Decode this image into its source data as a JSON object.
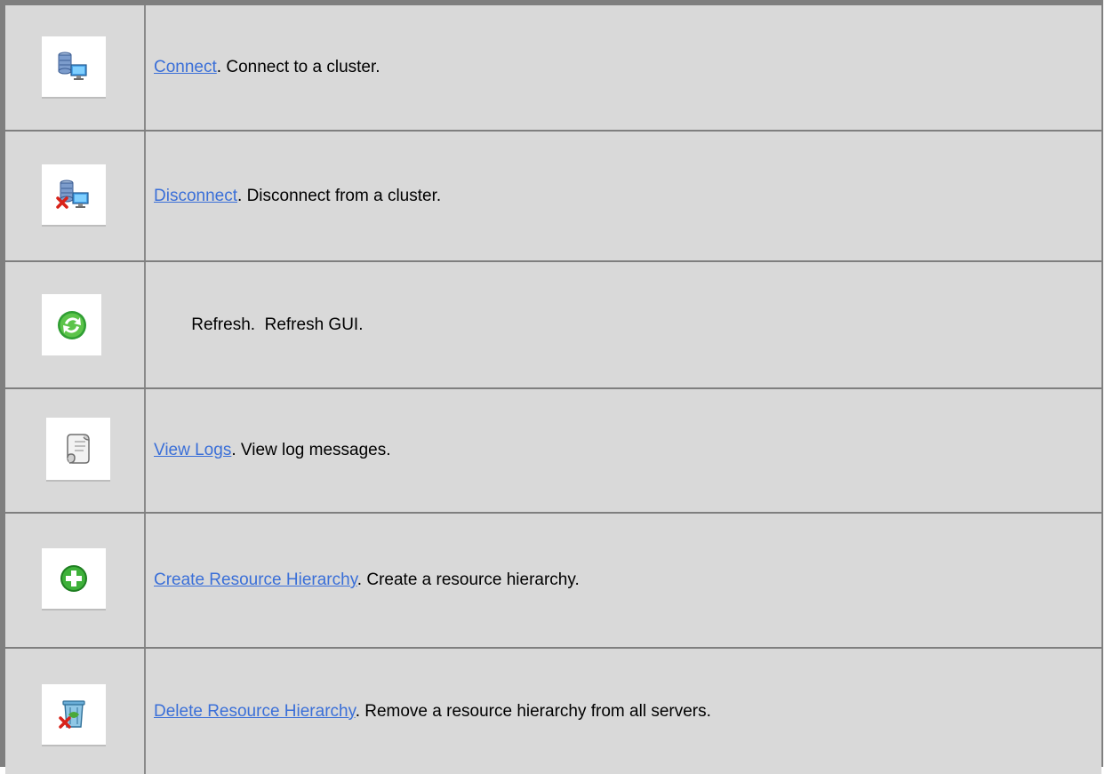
{
  "rows": [
    {
      "icon": "connect-server-icon",
      "link": "Connect",
      "sep": ". ",
      "desc": "Connect to a cluster."
    },
    {
      "icon": "disconnect-server-icon",
      "link": "Disconnect",
      "sep": ". ",
      "desc": "Disconnect from a cluster."
    },
    {
      "icon": "refresh-icon",
      "label": "Refresh.",
      "desc": "  Refresh GUI."
    },
    {
      "icon": "log-scroll-icon",
      "link": "View Logs",
      "sep": ". ",
      "desc": "View log messages."
    },
    {
      "icon": "add-plus-icon",
      "link": "Create Resource Hierarchy",
      "sep": ". ",
      "desc": "Create a resource hierarchy."
    },
    {
      "icon": "delete-trash-icon",
      "link": "Delete Resource Hierarchy",
      "sep": ". ",
      "desc": "Remove a resource hierarchy from all servers."
    }
  ],
  "colors": {
    "link": "#3a6fd8",
    "cell_background": "#d9d9d9",
    "border": "#7f7f7f"
  }
}
